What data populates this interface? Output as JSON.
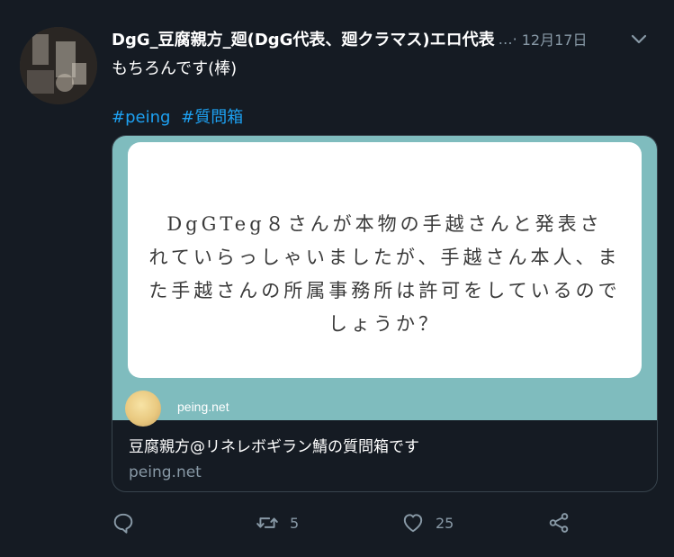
{
  "tweet": {
    "display_name": "DgG_豆腐親方_廻(DgG代表、廻クラマス)エロ代表",
    "separator": "…·",
    "date": "12月17日",
    "text": "もちろんです(棒)",
    "hashtags": [
      "#peing",
      "#質問箱"
    ]
  },
  "card": {
    "image_lines": [
      "DgGTeg８さんが本物の手越さんと発表さ",
      "れていらっしゃいましたが、手越さん本人、ま",
      "た手越さんの所属事務所は許可をしているので",
      "しょうか？"
    ],
    "image_domain": "peing.net",
    "title": "豆腐親方@リネレボギラン鯖の質問箱です",
    "domain": "peing.net"
  },
  "actions": {
    "reply_icon": "reply-icon",
    "retweet_icon": "retweet-icon",
    "retweet_count": "5",
    "like_icon": "like-icon",
    "like_count": "25",
    "share_icon": "share-icon"
  },
  "colors": {
    "background": "#151b23",
    "hashtag": "#1da1f2",
    "muted": "#8899a6",
    "card_image_bg": "#7fbcbe"
  }
}
